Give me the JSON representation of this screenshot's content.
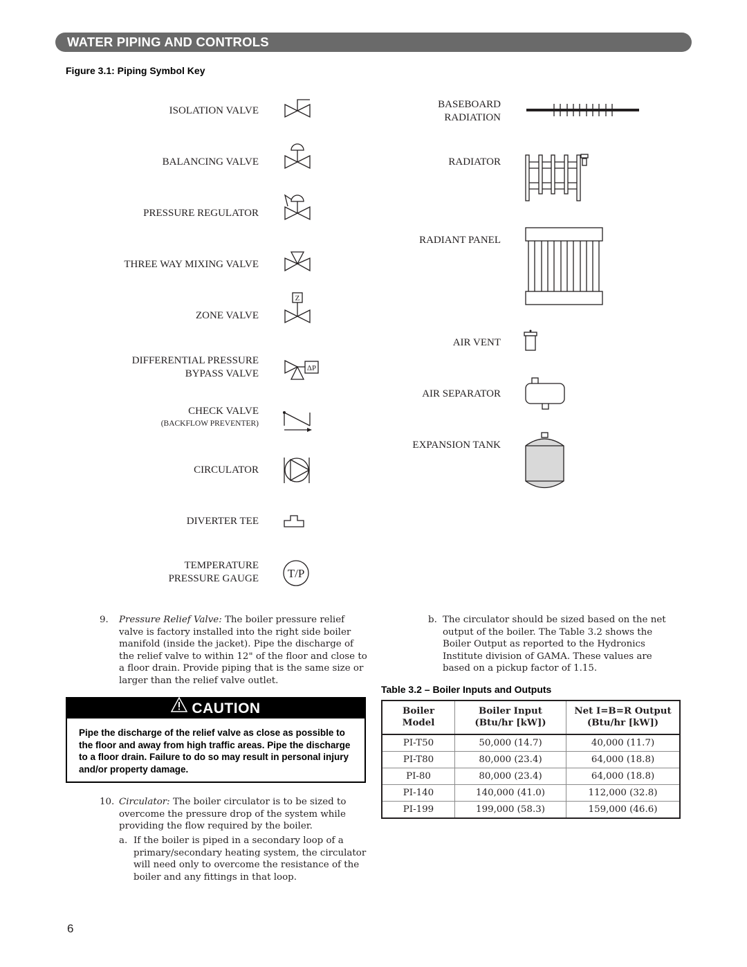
{
  "header": {
    "section_title": "WATER PIPING AND CONTROLS"
  },
  "figure": {
    "title": "Figure 3.1: Piping Symbol Key",
    "left_symbols": [
      {
        "label": "ISOLATION VALVE",
        "icon": "isolation-valve-icon"
      },
      {
        "label": "BALANCING VALVE",
        "icon": "balancing-valve-icon"
      },
      {
        "label": "PRESSURE REGULATOR",
        "icon": "pressure-regulator-icon"
      },
      {
        "label": "THREE WAY MIXING VALVE",
        "icon": "three-way-mixing-valve-icon"
      },
      {
        "label": "ZONE VALVE",
        "icon": "zone-valve-icon",
        "badge": "Z"
      },
      {
        "label_line1": "DIFFERENTIAL PRESSURE",
        "label_line2": "BYPASS VALVE",
        "icon": "differential-pressure-bypass-valve-icon",
        "badge": "ΔP"
      },
      {
        "label": "CHECK VALVE",
        "sublabel": "(BACKFLOW PREVENTER)",
        "icon": "check-valve-icon"
      },
      {
        "label": "CIRCULATOR",
        "icon": "circulator-icon"
      },
      {
        "label": "DIVERTER TEE",
        "icon": "diverter-tee-icon"
      },
      {
        "label_line1": "TEMPERATURE",
        "label_line2": "PRESSURE GAUGE",
        "icon": "temperature-pressure-gauge-icon",
        "badge": "T/P"
      }
    ],
    "right_symbols": [
      {
        "label_line1": "BASEBOARD",
        "label_line2": "RADIATION",
        "icon": "baseboard-radiation-icon"
      },
      {
        "label": "RADIATOR",
        "icon": "radiator-icon"
      },
      {
        "label": "RADIANT PANEL",
        "icon": "radiant-panel-icon"
      },
      {
        "label": "AIR VENT",
        "icon": "air-vent-icon"
      },
      {
        "label": "AIR SEPARATOR",
        "icon": "air-separator-icon"
      },
      {
        "label": "EXPANSION TANK",
        "icon": "expansion-tank-icon"
      }
    ]
  },
  "item9": {
    "number": "9.",
    "lead": "Pressure Relief Valve:",
    "text": " The boiler pressure relief valve is factory installed into the right side boiler manifold (inside the jacket). Pipe the discharge of the relief valve to within 12\" of the floor and close to a floor drain.  Provide piping that is the same size or larger than the relief valve outlet."
  },
  "caution": {
    "heading": "CAUTION",
    "icon": "warning-triangle-icon",
    "text": "Pipe the discharge of the relief valve as close as possible to the floor and away from high traffic areas. Pipe the discharge to a floor drain. Failure to do so may result in personal injury and/or property damage."
  },
  "item10": {
    "number": "10.",
    "lead": "Circulator:",
    "text": " The boiler circulator is to be sized to overcome the pressure drop of the system while providing the flow required by the boiler.",
    "sub_a": {
      "letter": "a.",
      "text": "If the boiler is piped in a secondary loop of a primary/secondary heating system, the circulator will need only to overcome the resistance of the boiler and any fittings in that loop."
    },
    "sub_b": {
      "letter": "b.",
      "text": "The circulator should be sized based on the net output of the boiler. The Table 3.2 shows the Boiler Output as reported to the Hydronics Institute division of GAMA. These values are based on a pickup factor of 1.15."
    }
  },
  "table": {
    "title": "Table 3.2 – Boiler Inputs and Outputs",
    "headers": [
      {
        "line1": "Boiler",
        "line2": "Model"
      },
      {
        "line1": "Boiler Input",
        "line2": "(Btu/hr [kW])"
      },
      {
        "line1": "Net I=B=R Output",
        "line2": "(Btu/hr [kW])"
      }
    ],
    "rows": [
      [
        "PI-T50",
        "50,000 (14.7)",
        "40,000 (11.7)"
      ],
      [
        "PI-T80",
        "80,000 (23.4)",
        "64,000 (18.8)"
      ],
      [
        "PI-80",
        "80,000 (23.4)",
        "64,000 (18.8)"
      ],
      [
        "PI-140",
        "140,000 (41.0)",
        "112,000 (32.8)"
      ],
      [
        "PI-199",
        "199,000 (58.3)",
        "159,000 (46.6)"
      ]
    ]
  },
  "footer": {
    "page_number": "6"
  }
}
